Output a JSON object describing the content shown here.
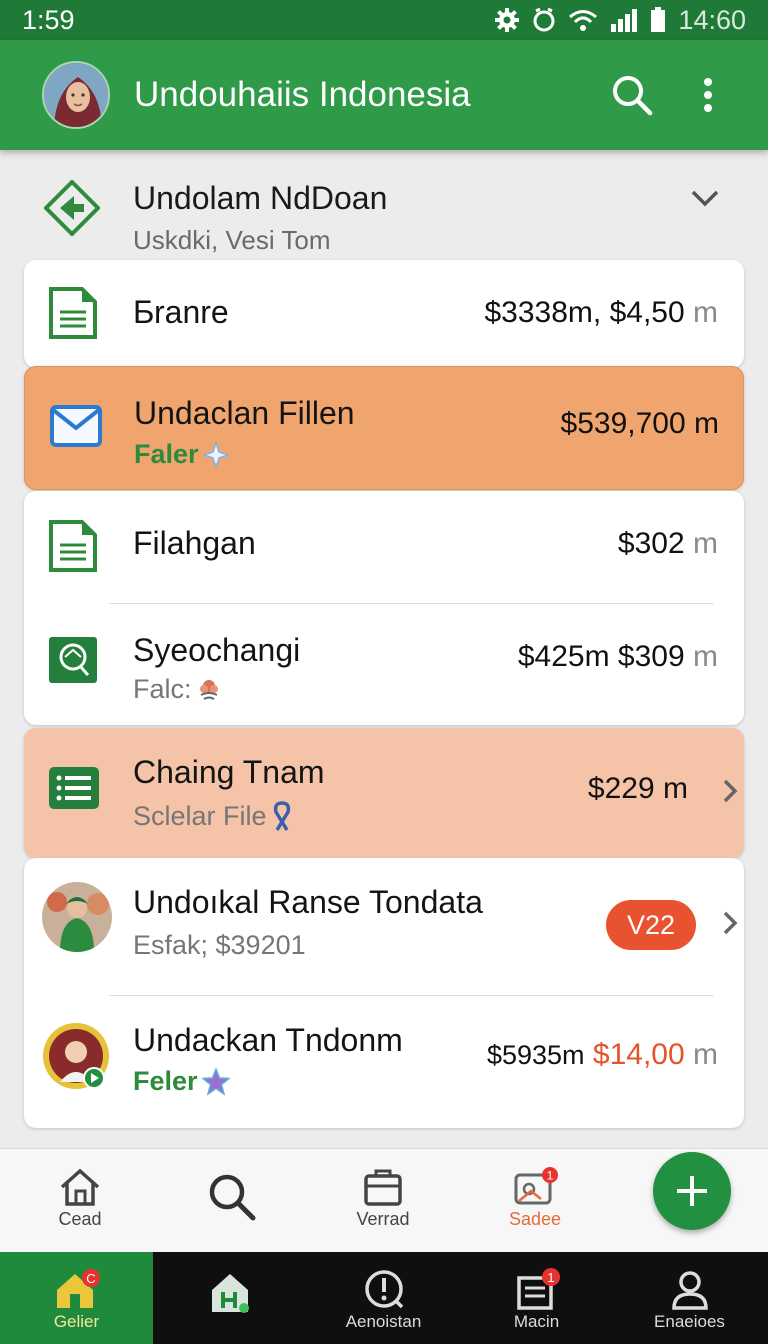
{
  "status_bar": {
    "time": "1:59",
    "clock_right": "14:60",
    "icons": [
      "settings-icon",
      "alarm-icon",
      "wifi-icon",
      "signal-icon",
      "battery-icon"
    ]
  },
  "app_bar": {
    "title": "Undouhaiis Indonesia",
    "icons": [
      "search-icon",
      "more-vert-icon"
    ]
  },
  "group_header": {
    "title": "Undolam NdDoan",
    "subtitle": "Uskdki, Vesi Tom",
    "icon": "tag-icon"
  },
  "items": [
    {
      "title": "Ƃranre",
      "amount": "$3338m, $4,50",
      "unit": "m",
      "icon": "document-icon"
    },
    {
      "title": "Undaclan Fillen",
      "subtitle": "Faler",
      "amount": "$539,700 m",
      "icon": "mail-icon",
      "highlight": "#f0a56e"
    },
    {
      "title": "Filahgan",
      "amount": "$302",
      "unit": "m",
      "icon": "document-icon"
    },
    {
      "title": "Syeochangi",
      "subtitle": "Falc:",
      "amount": "$425m $309",
      "unit": "m",
      "icon": "chat-icon"
    },
    {
      "title": "Chaing Tnam",
      "subtitle": "Sclelar File",
      "amount": "$229 m",
      "icon": "list-icon",
      "highlight": "#f5c4a8"
    },
    {
      "title": "Undoıkal Ranse Tondata",
      "subtitle": "Esfak; $39201",
      "badge": "V22",
      "icon": "avatar"
    },
    {
      "title": "Undackan Tndonm",
      "subtitle": "Feler",
      "amount_prefix": "$5935m",
      "amount_red": "$14,00",
      "unit": "m",
      "icon": "avatar"
    }
  ],
  "bottom_tabs": [
    {
      "label": "Cead",
      "icon": "home-icon"
    },
    {
      "label": "",
      "icon": "search-icon"
    },
    {
      "label": "Verrad",
      "icon": "briefcase-icon"
    },
    {
      "label": "Sadee",
      "icon": "media-icon",
      "badge": "1",
      "active": true
    }
  ],
  "fab": {
    "icon": "plus-icon"
  },
  "nav_bar": [
    {
      "label": "Gelier",
      "icon": "home-icon",
      "badge": "C",
      "active": true
    },
    {
      "label": "",
      "icon": "house-icon"
    },
    {
      "label": "Aenoistan",
      "icon": "alert-icon"
    },
    {
      "label": "Macin",
      "icon": "inbox-icon",
      "badge": "1"
    },
    {
      "label": "Enaeioes",
      "icon": "person-icon"
    }
  ],
  "colors": {
    "primary": "#2f9a48",
    "status_bar": "#1e7a36",
    "accent_orange": "#f0a56e",
    "accent_peach": "#f5c4a8",
    "badge_red": "#e8522e",
    "nav_active": "#1f8a3c"
  }
}
